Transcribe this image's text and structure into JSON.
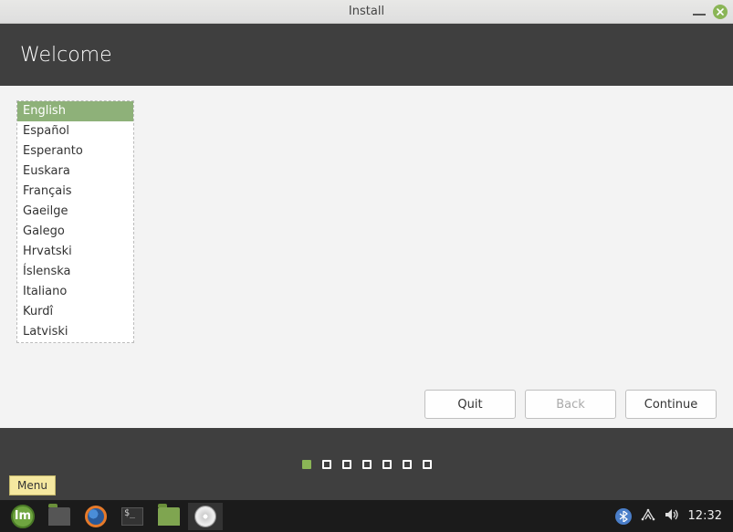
{
  "window": {
    "title": "Install"
  },
  "header": {
    "title": "Welcome"
  },
  "languages": {
    "selected_index": 0,
    "items": [
      "English",
      "Español",
      "Esperanto",
      "Euskara",
      "Français",
      "Gaeilge",
      "Galego",
      "Hrvatski",
      "Íslenska",
      "Italiano",
      "Kurdî",
      "Latviski"
    ]
  },
  "buttons": {
    "quit": "Quit",
    "back": "Back",
    "continue": "Continue",
    "back_enabled": false
  },
  "progress": {
    "total": 7,
    "current": 0
  },
  "tooltip": {
    "menu": "Menu"
  },
  "taskbar": {
    "time": "12:32"
  }
}
